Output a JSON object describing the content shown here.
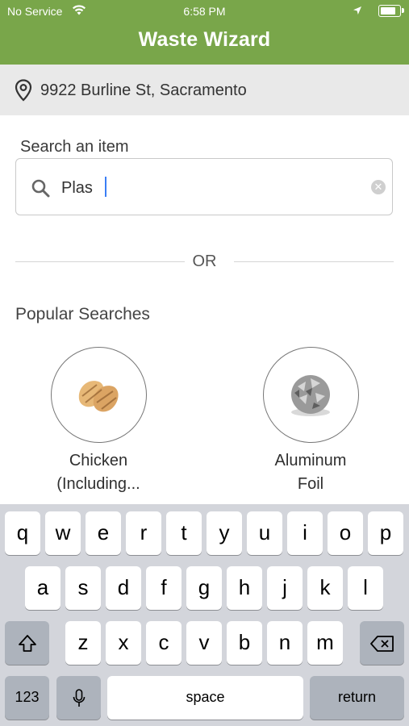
{
  "status_bar": {
    "carrier": "No Service",
    "time": "6:58 PM"
  },
  "header": {
    "title": "Waste Wizard"
  },
  "address": {
    "text": "9922 Burline St, Sacramento"
  },
  "search": {
    "label": "Search an item",
    "value": "Plas"
  },
  "divider": {
    "text": "OR"
  },
  "popular": {
    "title": "Popular Searches",
    "items": [
      {
        "line1": "Chicken",
        "line2": "(Including..."
      },
      {
        "line1": "Aluminum",
        "line2": "Foil"
      }
    ]
  },
  "keyboard": {
    "row1": [
      "q",
      "w",
      "e",
      "r",
      "t",
      "y",
      "u",
      "i",
      "o",
      "p"
    ],
    "row2": [
      "a",
      "s",
      "d",
      "f",
      "g",
      "h",
      "j",
      "k",
      "l"
    ],
    "row3": [
      "z",
      "x",
      "c",
      "v",
      "b",
      "n",
      "m"
    ],
    "numbers_label": "123",
    "space_label": "space",
    "return_label": "return"
  },
  "colors": {
    "brand_green": "#79a64a",
    "address_bg": "#e9e9e9",
    "keyboard_bg": "#d3d5db"
  }
}
